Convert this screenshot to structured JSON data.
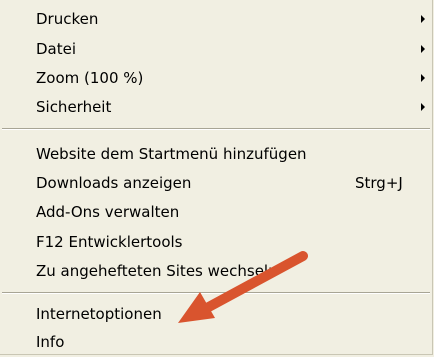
{
  "menu": {
    "group1": [
      {
        "label": "Drucken",
        "submenu_icon": "submenu-arrow-icon"
      },
      {
        "label": "Datei",
        "submenu_icon": "submenu-arrow-icon"
      },
      {
        "label": "Zoom (100 %)",
        "submenu_icon": "submenu-arrow-icon"
      },
      {
        "label": "Sicherheit",
        "submenu_icon": "submenu-arrow-icon"
      }
    ],
    "group2": [
      {
        "label": "Website dem Startmenü hinzufügen"
      },
      {
        "label": "Downloads anzeigen",
        "shortcut": "Strg+J"
      },
      {
        "label": "Add-Ons verwalten"
      },
      {
        "label": "F12 Entwicklertools"
      },
      {
        "label": "Zu angehefteten Sites wechseln"
      }
    ],
    "group3": [
      {
        "label": "Internetoptionen"
      },
      {
        "label": "Info"
      }
    ]
  },
  "annotation": {
    "icon": "red-pointer-arrow-icon",
    "color": "#d9542e"
  },
  "colors": {
    "menu_background": "#f1efe2",
    "separator_dark": "#a8a595",
    "separator_light": "#ffffff",
    "text": "#000000"
  }
}
